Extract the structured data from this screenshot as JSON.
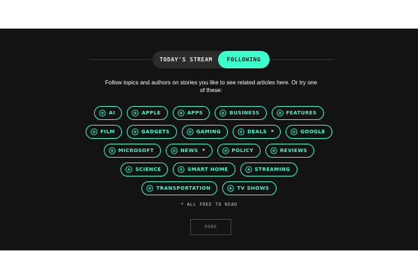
{
  "toggle": {
    "stream_label": "TODAY'S STREAM",
    "following_label": "FOLLOWING"
  },
  "intro_text": "Follow topics and authors on stories you like to see related articles here. Or try one of these:",
  "topic_rows": [
    [
      {
        "label": "AI",
        "star": ""
      },
      {
        "label": "APPLE",
        "star": ""
      },
      {
        "label": "APPS",
        "star": ""
      },
      {
        "label": "BUSINESS",
        "star": ""
      },
      {
        "label": "FEATURES",
        "star": ""
      }
    ],
    [
      {
        "label": "FILM",
        "star": ""
      },
      {
        "label": "GADGETS",
        "star": ""
      },
      {
        "label": "GAMING",
        "star": ""
      },
      {
        "label": "DEALS",
        "star": "*"
      },
      {
        "label": "GOOGLE",
        "star": ""
      }
    ],
    [
      {
        "label": "MICROSOFT",
        "star": ""
      },
      {
        "label": "NEWS",
        "star": "*"
      },
      {
        "label": "POLICY",
        "star": ""
      },
      {
        "label": "REVIEWS",
        "star": ""
      }
    ],
    [
      {
        "label": "SCIENCE",
        "star": ""
      },
      {
        "label": "SMART HOME",
        "star": ""
      },
      {
        "label": "STREAMING",
        "star": ""
      }
    ],
    [
      {
        "label": "TRANSPORTATION",
        "star": ""
      },
      {
        "label": "TV SHOWS",
        "star": ""
      }
    ]
  ],
  "footnote": "* ALL FREE TO READ",
  "done_label": "DONE",
  "colors": {
    "accent": "#3cffd0",
    "background": "#131313",
    "toggle_bg": "#2b2b2b"
  },
  "icons": {
    "chip": "plus-circle-icon"
  }
}
